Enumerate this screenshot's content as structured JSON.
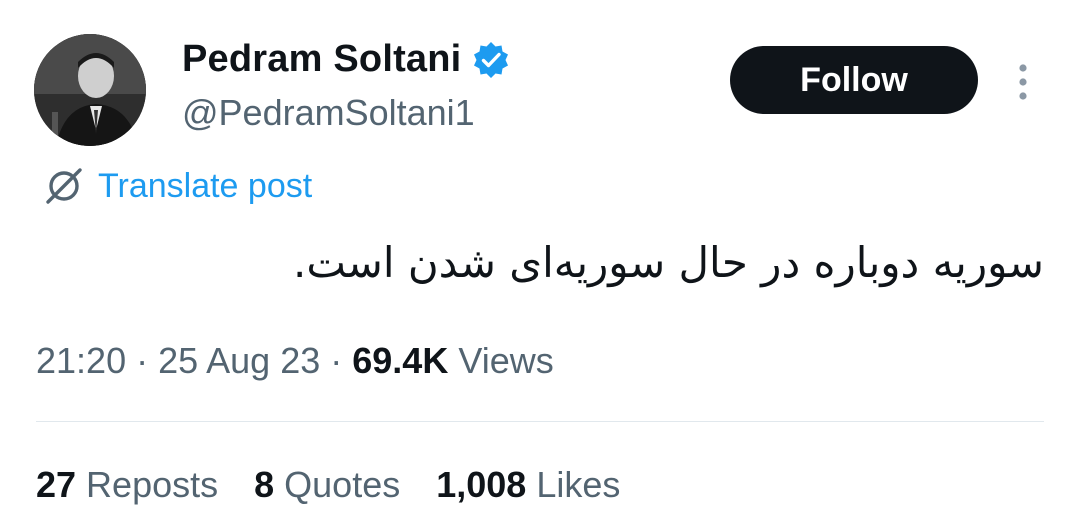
{
  "author": {
    "name": "Pedram Soltani",
    "handle": "@PedramSoltani1",
    "verified": true,
    "avatar": "profile-photo"
  },
  "follow_label": "Follow",
  "translate_label": "Translate post",
  "post": {
    "text": "سوریه دوباره در حال سوریه‌ای شدن است."
  },
  "meta": {
    "time": "21:20",
    "separator": "·",
    "date": "25 Aug 23",
    "views_count": "69.4K",
    "views_label": "Views"
  },
  "stats": {
    "reposts_count": "27",
    "reposts_label": "Reposts",
    "quotes_count": "8",
    "quotes_label": "Quotes",
    "likes_count": "1,008",
    "likes_label": "Likes"
  },
  "colors": {
    "accent": "#1d9bf0",
    "text": "#0f1419",
    "secondary": "#536471",
    "button_bg": "#0f1419"
  }
}
